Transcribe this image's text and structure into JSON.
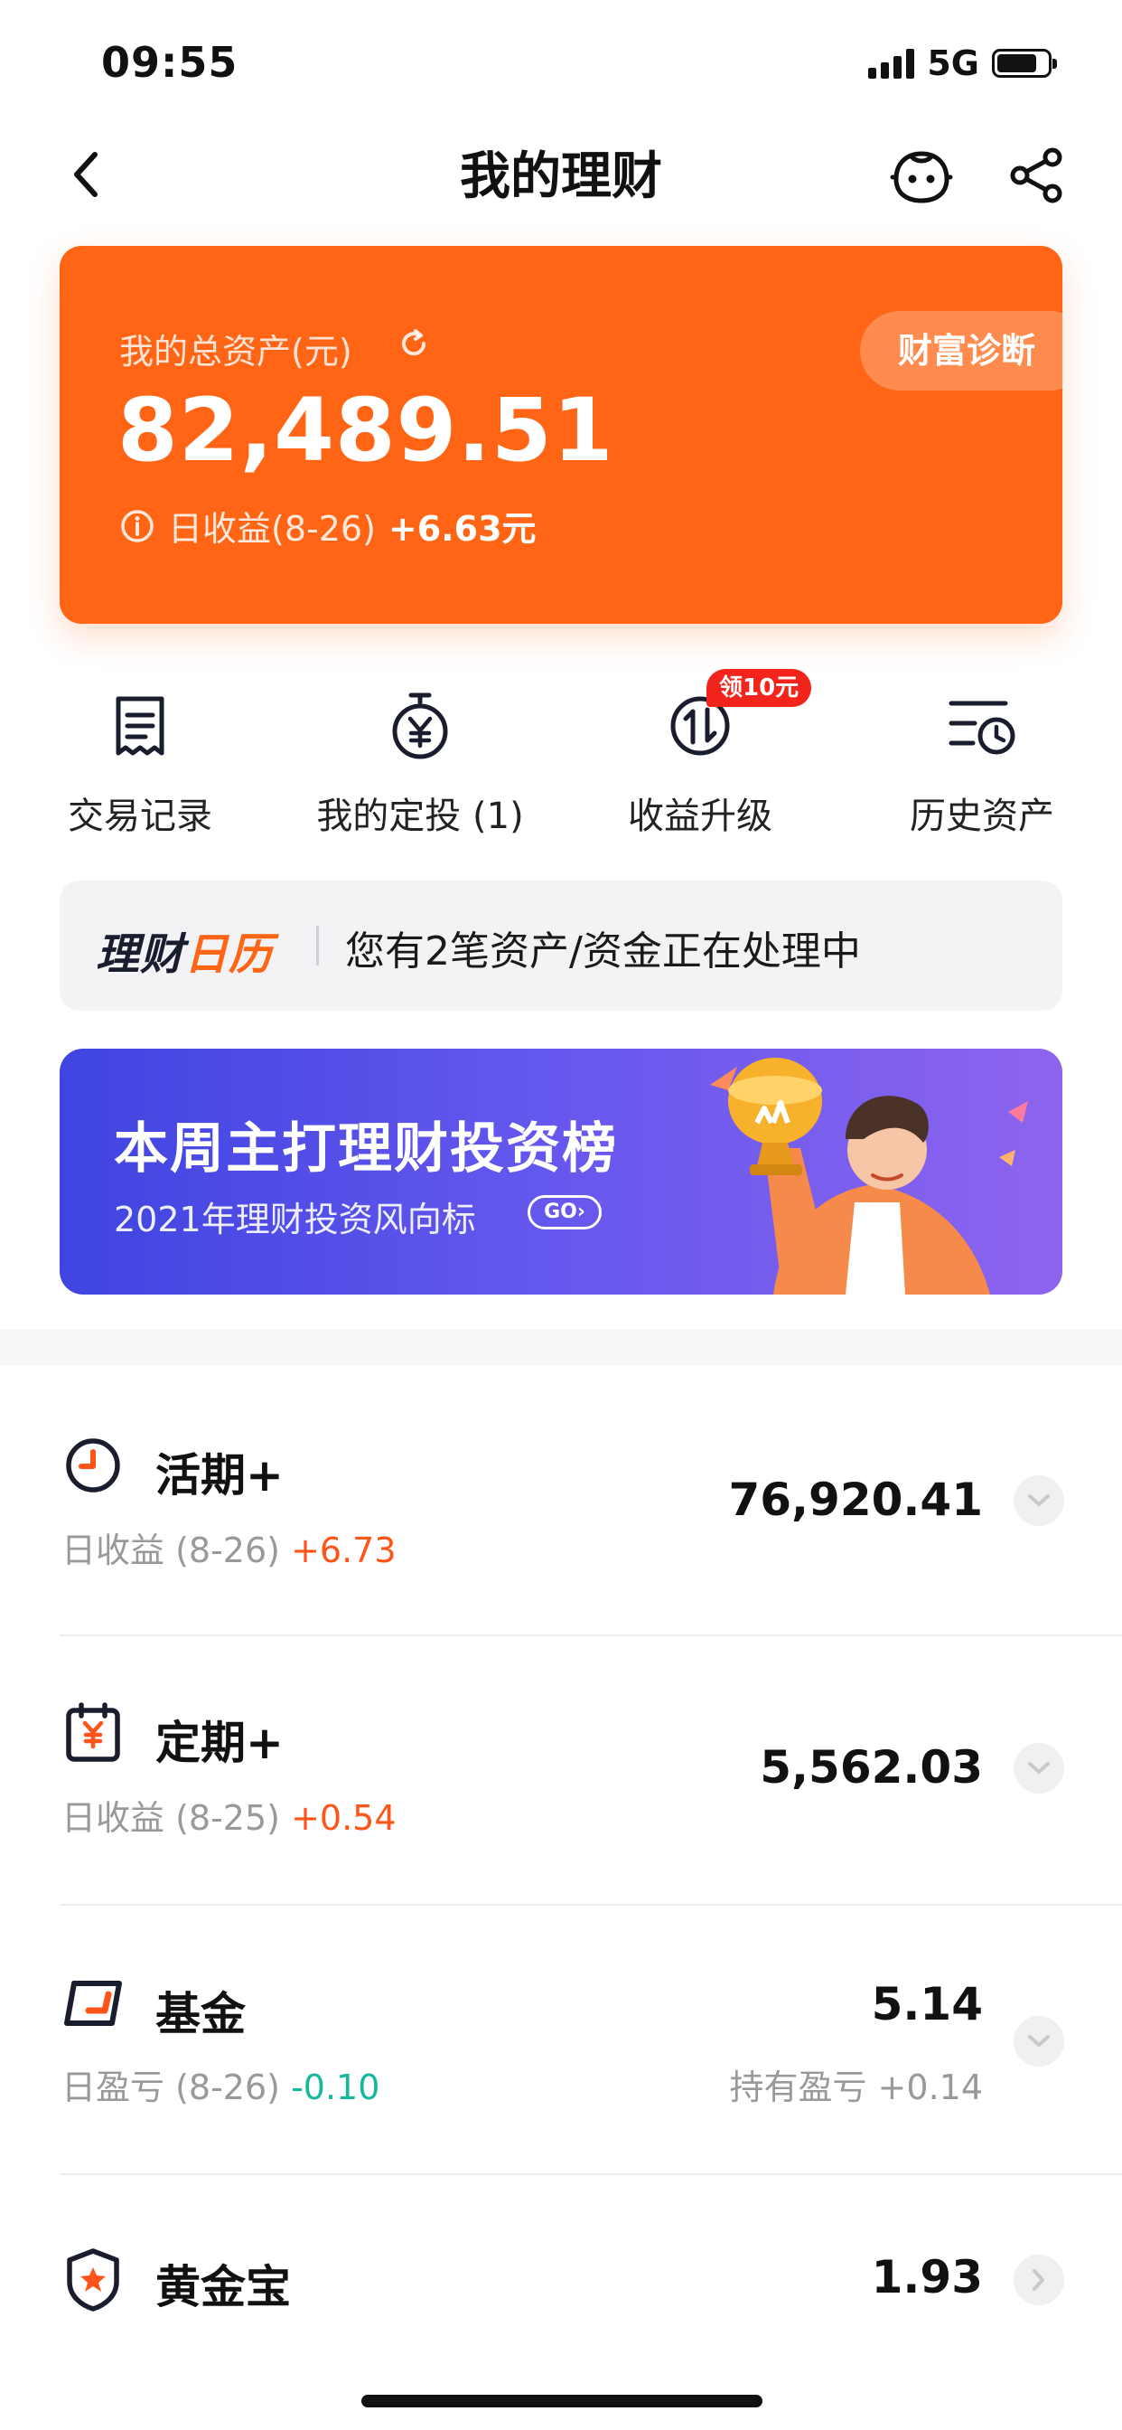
{
  "status_bar": {
    "time": "09:55",
    "network": "5G",
    "battery_level": 0.8
  },
  "nav": {
    "title": "我的理财"
  },
  "hero": {
    "label": "我的总资产(元)",
    "amount": "82,489.51",
    "daily_label": "日收益(8-26)",
    "daily_value": "+6.63元",
    "diagnosis_button": "财富诊断",
    "color": "#ff6514"
  },
  "quick_actions": [
    {
      "label": "交易记录",
      "icon": "receipt-icon"
    },
    {
      "label": "我的定投 (1)",
      "icon": "yuan-timer-icon"
    },
    {
      "label": "收益升级",
      "icon": "arrows-updown-circle-icon",
      "badge": "领10元"
    },
    {
      "label": "历史资产",
      "icon": "history-list-icon"
    }
  ],
  "calendar": {
    "logo_part1": "理财",
    "logo_part2": "日历",
    "message": "您有2笔资产/资金正在处理中"
  },
  "banner": {
    "title": "本周主打理财投资榜",
    "subtitle": "2021年理财投资风向标",
    "go": "GO"
  },
  "products": [
    {
      "name": "活期+",
      "icon": "clock-icon",
      "sub_label": "日收益 (8-26)",
      "sub_value": "+6.73",
      "sub_trend": "up",
      "amount": "76,920.41"
    },
    {
      "name": "定期+",
      "icon": "calendar-yuan-icon",
      "sub_label": "日收益 (8-25)",
      "sub_value": "+0.54",
      "sub_trend": "up",
      "amount": "5,562.03"
    },
    {
      "name": "基金",
      "icon": "fund-icon",
      "sub_label": "日盈亏 (8-26)",
      "sub_value": "-0.10",
      "sub_trend": "down",
      "amount": "5.14",
      "hold_label": "持有盈亏",
      "hold_value": "+0.14"
    },
    {
      "name": "黄金宝",
      "icon": "gold-shield-icon",
      "amount": "1.93"
    }
  ],
  "colors": {
    "accent": "#ff6514",
    "gain": "#ff5417",
    "loss": "#16b79b",
    "banner_start": "#3f44e0",
    "banner_end": "#8d64ee"
  }
}
